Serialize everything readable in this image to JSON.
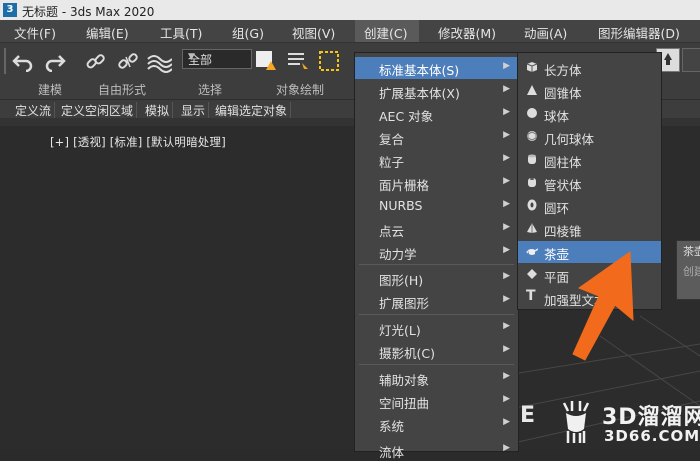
{
  "window": {
    "app_icon": "3",
    "title": "无标题 - 3ds Max 2020"
  },
  "menubar": {
    "items": [
      {
        "name": "file",
        "label": "文件(F)"
      },
      {
        "name": "edit",
        "label": "编辑(E)"
      },
      {
        "name": "tools",
        "label": "工具(T)"
      },
      {
        "name": "group",
        "label": "组(G)"
      },
      {
        "name": "view",
        "label": "视图(V)"
      },
      {
        "name": "create",
        "label": "创建(C)"
      },
      {
        "name": "modifiers",
        "label": "修改器(M)"
      },
      {
        "name": "animation",
        "label": "动画(A)"
      },
      {
        "name": "graph-editors",
        "label": "图形编辑器(D)"
      }
    ]
  },
  "toolbar": {
    "selection_filter": "全部"
  },
  "ribbon": {
    "tabs": [
      "建模",
      "自由形式",
      "选择",
      "对象绘制"
    ],
    "subtabs": [
      "定义流",
      "定义空闲区域",
      "模拟",
      "显示",
      "编辑选定对象"
    ]
  },
  "viewport": {
    "label": "[+] [透视] [标准] [默认明暗处理]"
  },
  "create_menu": {
    "items": [
      {
        "label": "标准基本体(S)",
        "submenu": true,
        "highlight": true
      },
      {
        "label": "扩展基本体(X)",
        "submenu": true
      },
      {
        "label": "AEC 对象",
        "submenu": true
      },
      {
        "label": "复合",
        "submenu": true
      },
      {
        "label": "粒子",
        "submenu": true
      },
      {
        "label": "面片栅格",
        "submenu": true
      },
      {
        "label": "NURBS",
        "submenu": true
      },
      {
        "label": "点云",
        "submenu": true
      },
      {
        "label": "动力学",
        "submenu": true
      },
      {
        "label": "图形(H)",
        "submenu": true
      },
      {
        "label": "扩展图形",
        "submenu": true
      },
      {
        "label": "灯光(L)",
        "submenu": true
      },
      {
        "label": "摄影机(C)",
        "submenu": true
      },
      {
        "label": "辅助对象",
        "submenu": true
      },
      {
        "label": "空间扭曲",
        "submenu": true
      },
      {
        "label": "系统",
        "submenu": true
      },
      {
        "label": "流体",
        "submenu": true
      }
    ]
  },
  "primitives_submenu": {
    "items": [
      {
        "label": "长方体",
        "icon": "box-icon"
      },
      {
        "label": "圆锥体",
        "icon": "cone-icon"
      },
      {
        "label": "球体",
        "icon": "sphere-icon"
      },
      {
        "label": "几何球体",
        "icon": "geosphere-icon"
      },
      {
        "label": "圆柱体",
        "icon": "cylinder-icon"
      },
      {
        "label": "管状体",
        "icon": "tube-icon"
      },
      {
        "label": "圆环",
        "icon": "torus-icon"
      },
      {
        "label": "四棱锥",
        "icon": "pyramid-icon"
      },
      {
        "label": "茶壶",
        "icon": "teapot-icon",
        "highlight": true
      },
      {
        "label": "平面",
        "icon": "plane-icon"
      },
      {
        "label": "加强型文本",
        "icon": "text-icon"
      }
    ]
  },
  "tooltip": {
    "line1": "茶壶",
    "line2": "创建"
  },
  "watermark": {
    "brand": "3D溜溜网",
    "url": "3D66.COM"
  },
  "colors": {
    "highlight": "#4d7ebc",
    "arrow": "#f26a1b",
    "menu_bg": "#444444"
  }
}
